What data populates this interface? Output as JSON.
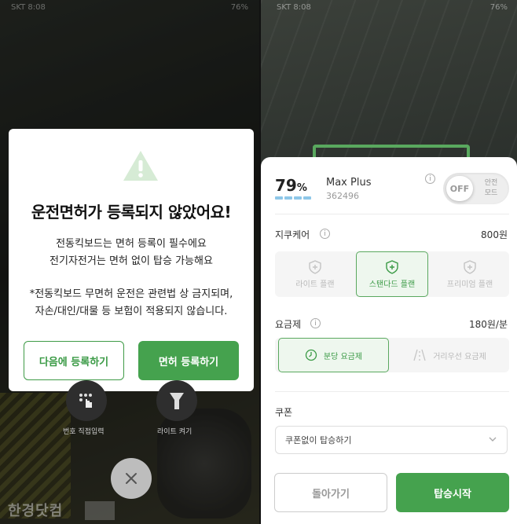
{
  "left": {
    "status_carrier": "SKT 8:08",
    "status_battery": "76%",
    "dialog": {
      "icon": "warning-triangle-icon",
      "title": "운전면허가 등록되지 않았어요!",
      "body_lines": [
        "전동킥보드는 면허 등록이 필수에요",
        "전기자전거는 면허 없이 탑승 가능해요"
      ],
      "note_lines": [
        "*전동킥보드 무면허 운전은 관련법 상 금지되며,",
        "자손/대인/대물 등 보험이 적용되지 않습니다."
      ],
      "later_button": "다음에 등록하기",
      "register_button": "면허 등록하기"
    },
    "bottom": {
      "manual_input_label": "번호 직접입력",
      "flashlight_label": "라이트 켜기",
      "close_icon": "close-icon"
    },
    "watermark": "한경닷컴"
  },
  "right": {
    "status_carrier": "SKT 8:08",
    "status_battery": "76%",
    "device": {
      "battery_value": "79",
      "battery_unit": "%",
      "battery_level": 0.79,
      "name": "Max Plus",
      "id": "362496"
    },
    "safe_mode": {
      "state": "OFF",
      "label_line1": "안전",
      "label_line2": "모드"
    },
    "care": {
      "label": "지쿠케어",
      "price": "800원",
      "plans": [
        {
          "label": "라이트 플랜",
          "selected": false
        },
        {
          "label": "스탠다드 플랜",
          "selected": true
        },
        {
          "label": "프리미엄 플랜",
          "selected": false
        }
      ]
    },
    "fee": {
      "label": "요금제",
      "price": "180원/분",
      "options": [
        {
          "label": "분당 요금제",
          "selected": true
        },
        {
          "label": "거리우선 요금제",
          "selected": false
        }
      ]
    },
    "coupon": {
      "label": "쿠폰",
      "selected": "쿠폰없이 탑승하기"
    },
    "back_button": "돌아가기",
    "start_button": "탑승시작",
    "accent": "#45a24e"
  }
}
